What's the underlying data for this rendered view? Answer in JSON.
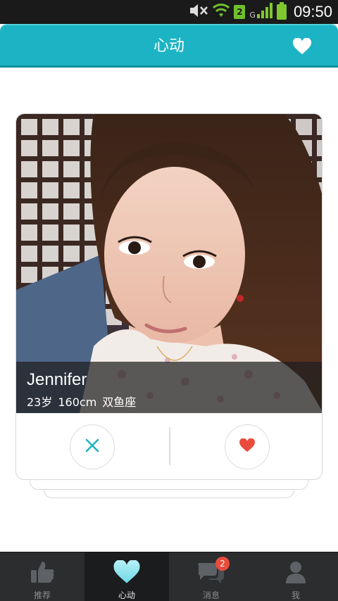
{
  "status_bar": {
    "sim_slot": "2",
    "network_type": "G",
    "time": "09:50",
    "icons": [
      "mute-icon",
      "wifi-icon",
      "sim-icon",
      "signal-icon",
      "battery-icon"
    ]
  },
  "header": {
    "title": "心动",
    "accent_color": "#1cb4c4",
    "right_icon": "heart-icon"
  },
  "profile": {
    "name": "Jennifer",
    "age": "23岁",
    "height": "160cm",
    "zodiac": "双鱼座"
  },
  "actions": {
    "skip_icon": "close-icon",
    "like_icon": "heart-icon",
    "skip_color": "#1cb4c4",
    "like_color": "#e94b3c"
  },
  "tabs": [
    {
      "label": "推荐",
      "icon": "thumbs-up-icon",
      "active": false
    },
    {
      "label": "心动",
      "icon": "heart-icon",
      "active": true
    },
    {
      "label": "消息",
      "icon": "chat-icon",
      "active": false,
      "badge": "2"
    },
    {
      "label": "我",
      "icon": "user-icon",
      "active": false
    }
  ]
}
